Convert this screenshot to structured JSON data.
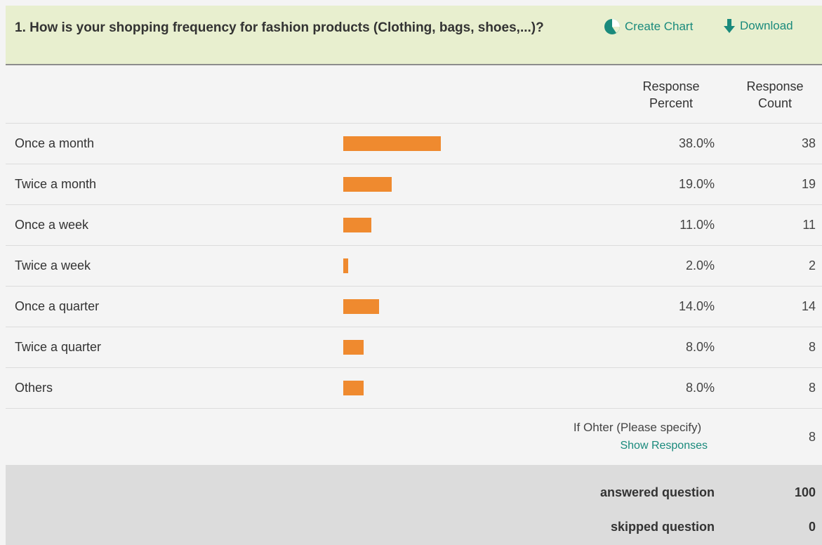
{
  "question": {
    "title": "1. How is your shopping frequency for fashion products (Clothing, bags, shoes,...)?",
    "create_chart_label": "Create Chart",
    "download_label": "Download",
    "create_chart_icon": "pie-chart-icon",
    "download_icon": "download-arrow-icon"
  },
  "columns": {
    "percent_label": "Response Percent",
    "count_label": "Response Count"
  },
  "rows": [
    {
      "label": "Once a month",
      "percent": "38.0%",
      "count": "38",
      "fraction": 0.38
    },
    {
      "label": "Twice a month",
      "percent": "19.0%",
      "count": "19",
      "fraction": 0.19
    },
    {
      "label": "Once a week",
      "percent": "11.0%",
      "count": "11",
      "fraction": 0.11
    },
    {
      "label": "Twice a week",
      "percent": "2.0%",
      "count": "2",
      "fraction": 0.02
    },
    {
      "label": "Once a quarter",
      "percent": "14.0%",
      "count": "14",
      "fraction": 0.14
    },
    {
      "label": "Twice a quarter",
      "percent": "8.0%",
      "count": "8",
      "fraction": 0.08
    },
    {
      "label": "Others",
      "percent": "8.0%",
      "count": "8",
      "fraction": 0.08
    }
  ],
  "other": {
    "label": "If Ohter (Please specify)",
    "link": "Show Responses",
    "count": "8"
  },
  "summary": {
    "answered_label": "answered question",
    "answered_value": "100",
    "skipped_label": "skipped question",
    "skipped_value": "0"
  },
  "colors": {
    "bar": "#ef8a2f",
    "link": "#1a8a7c",
    "header_bg": "#e8efcf"
  }
}
